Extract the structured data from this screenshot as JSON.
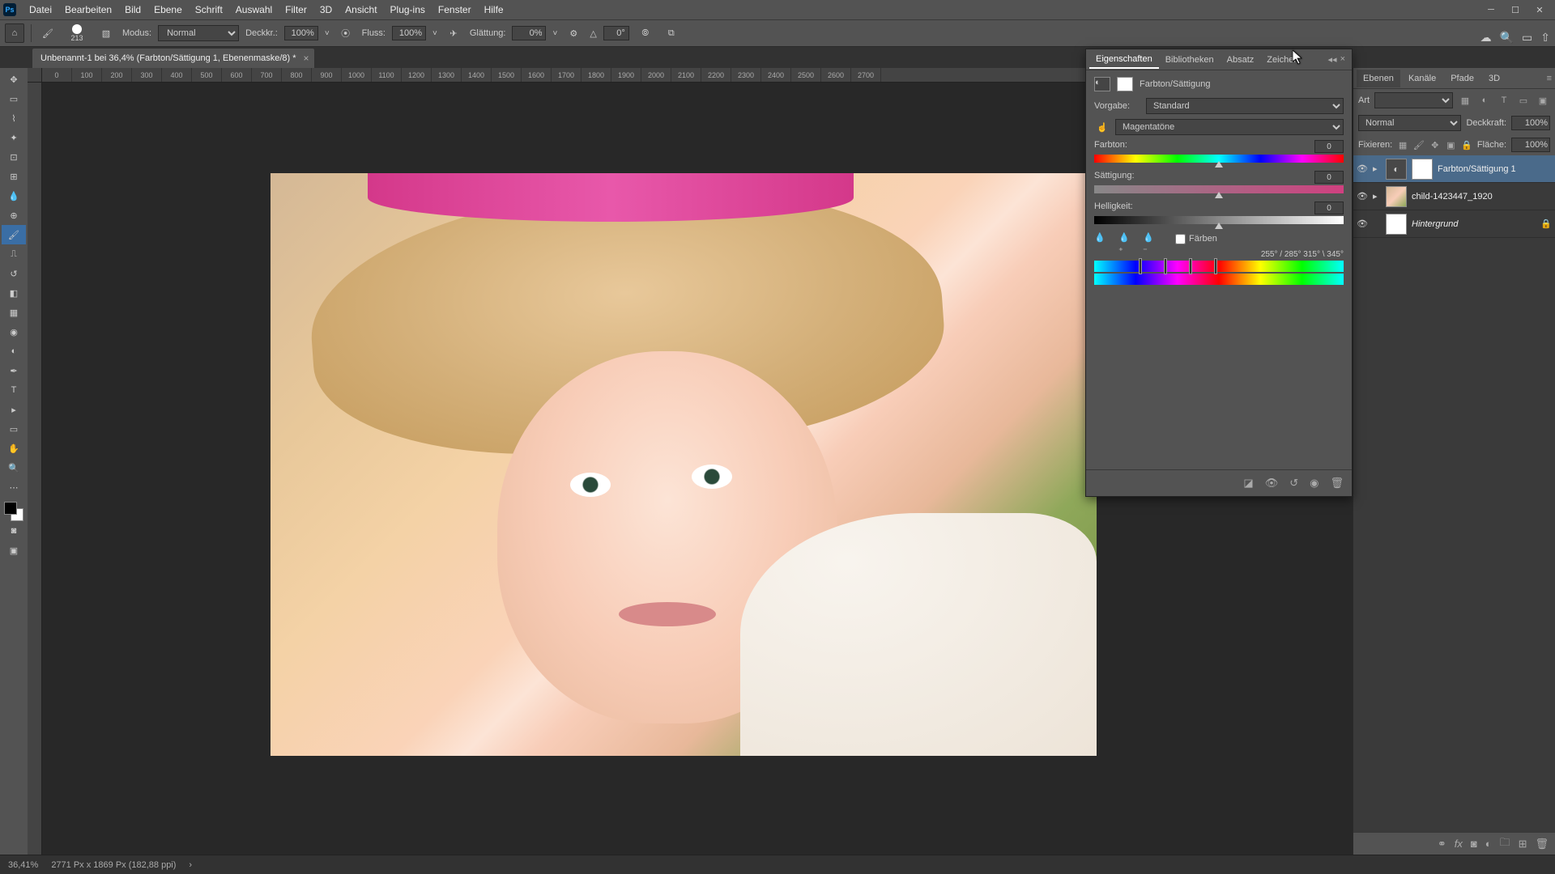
{
  "menus": [
    "Datei",
    "Bearbeiten",
    "Bild",
    "Ebene",
    "Schrift",
    "Auswahl",
    "Filter",
    "3D",
    "Ansicht",
    "Plug-ins",
    "Fenster",
    "Hilfe"
  ],
  "options": {
    "brush_size": "213",
    "modus_label": "Modus:",
    "modus_value": "Normal",
    "deckkr_label": "Deckkr.:",
    "deckkr_value": "100%",
    "fluss_label": "Fluss:",
    "fluss_value": "100%",
    "glatt_label": "Glättung:",
    "glatt_value": "0%",
    "angle_label": "△",
    "angle_value": "0°"
  },
  "doc_tab": "Unbenannt-1 bei 36,4% (Farbton/Sättigung 1, Ebenenmaske/8) *",
  "ruler_marks": [
    "0",
    "100",
    "200",
    "300",
    "400",
    "500",
    "600",
    "700",
    "800",
    "900",
    "1000",
    "1100",
    "1200",
    "1300",
    "1400",
    "1500",
    "1600",
    "1700",
    "1800",
    "1900",
    "2000",
    "2100",
    "2200",
    "2300",
    "2400",
    "2500",
    "2600",
    "2700"
  ],
  "status": {
    "zoom": "36,41%",
    "info": "2771 Px x 1869 Px (182,88 ppi)"
  },
  "right_tabs": [
    "Ebenen",
    "Kanäle",
    "Pfade",
    "3D"
  ],
  "layers": {
    "kind_label": "Art",
    "blend_mode": "Normal",
    "opacity_label": "Deckkraft:",
    "opacity_value": "100%",
    "lock_label": "Fixieren:",
    "fill_label": "Fläche:",
    "fill_value": "100%",
    "items": [
      {
        "name": "Farbton/Sättigung 1",
        "type": "adj",
        "sel": true
      },
      {
        "name": "child-1423447_1920",
        "type": "img",
        "sel": false
      },
      {
        "name": "Hintergrund",
        "type": "bg",
        "sel": false,
        "italic": true,
        "locked": true
      }
    ]
  },
  "props": {
    "tabs": [
      "Eigenschaften",
      "Bibliotheken",
      "Absatz",
      "Zeichen"
    ],
    "title": "Farbton/Sättigung",
    "preset_label": "Vorgabe:",
    "preset_value": "Standard",
    "channel_value": "Magentatöne",
    "hue_label": "Farbton:",
    "hue_value": "0",
    "sat_label": "Sättigung:",
    "sat_value": "0",
    "lit_label": "Helligkeit:",
    "lit_value": "0",
    "colorize_label": "Färben",
    "range_readout": "255° / 285°      315° \\ 345°"
  }
}
